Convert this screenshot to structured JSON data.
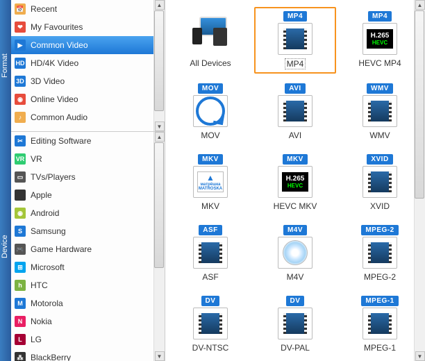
{
  "rail": {
    "format": "Format",
    "device": "Device"
  },
  "sidebar": {
    "format": [
      {
        "label": "Recent",
        "icon": "recent-icon",
        "color": "#f0ad4e",
        "glyph": "📅"
      },
      {
        "label": "My Favourites",
        "icon": "favourites-icon",
        "color": "#e74c3c",
        "glyph": "❤"
      },
      {
        "label": "Common Video",
        "icon": "common-video-icon",
        "color": "#1e78d6",
        "glyph": "▶",
        "selected": true
      },
      {
        "label": "HD/4K Video",
        "icon": "hd-icon",
        "color": "#1e78d6",
        "glyph": "HD"
      },
      {
        "label": "3D Video",
        "icon": "3d-icon",
        "color": "#1e78d6",
        "glyph": "3D"
      },
      {
        "label": "Online Video",
        "icon": "online-video-icon",
        "color": "#e74c3c",
        "glyph": "◉"
      },
      {
        "label": "Common Audio",
        "icon": "audio-icon",
        "color": "#f0ad4e",
        "glyph": "♪"
      }
    ],
    "device": [
      {
        "label": "Editing Software",
        "icon": "editing-icon",
        "color": "#1e78d6",
        "glyph": "✂"
      },
      {
        "label": "VR",
        "icon": "vr-icon",
        "color": "#2ecc71",
        "glyph": "VR"
      },
      {
        "label": "TVs/Players",
        "icon": "tv-icon",
        "color": "#555",
        "glyph": "▭"
      },
      {
        "label": "Apple",
        "icon": "apple-icon",
        "color": "#333",
        "glyph": ""
      },
      {
        "label": "Android",
        "icon": "android-icon",
        "color": "#a4c639",
        "glyph": "◉"
      },
      {
        "label": "Samsung",
        "icon": "samsung-icon",
        "color": "#1e78d6",
        "glyph": "S"
      },
      {
        "label": "Game Hardware",
        "icon": "game-icon",
        "color": "#555",
        "glyph": "🎮"
      },
      {
        "label": "Microsoft",
        "icon": "microsoft-icon",
        "color": "#00a4ef",
        "glyph": "⊞"
      },
      {
        "label": "HTC",
        "icon": "htc-icon",
        "color": "#7cb342",
        "glyph": "h"
      },
      {
        "label": "Motorola",
        "icon": "motorola-icon",
        "color": "#1e78d6",
        "glyph": "M"
      },
      {
        "label": "Nokia",
        "icon": "nokia-icon",
        "color": "#e91e63",
        "glyph": "N"
      },
      {
        "label": "LG",
        "icon": "lg-icon",
        "color": "#a50034",
        "glyph": "L"
      },
      {
        "label": "BlackBerry",
        "icon": "blackberry-icon",
        "color": "#333",
        "glyph": "⁂"
      }
    ]
  },
  "formats": [
    {
      "label": "All Devices",
      "badge": "",
      "kind": "devices"
    },
    {
      "label": "MP4",
      "badge": "MP4",
      "kind": "film",
      "selected": true
    },
    {
      "label": "HEVC MP4",
      "badge": "MP4",
      "kind": "hevc"
    },
    {
      "label": "MOV",
      "badge": "MOV",
      "kind": "mov"
    },
    {
      "label": "AVI",
      "badge": "AVI",
      "kind": "film"
    },
    {
      "label": "WMV",
      "badge": "WMV",
      "kind": "film"
    },
    {
      "label": "MKV",
      "badge": "MKV",
      "kind": "matroska"
    },
    {
      "label": "HEVC MKV",
      "badge": "MKV",
      "kind": "hevc"
    },
    {
      "label": "XVID",
      "badge": "XVID",
      "kind": "film"
    },
    {
      "label": "ASF",
      "badge": "ASF",
      "kind": "film"
    },
    {
      "label": "M4V",
      "badge": "M4V",
      "kind": "disc"
    },
    {
      "label": "MPEG-2",
      "badge": "MPEG-2",
      "kind": "film"
    },
    {
      "label": "DV-NTSC",
      "badge": "DV",
      "kind": "film"
    },
    {
      "label": "DV-PAL",
      "badge": "DV",
      "kind": "film"
    },
    {
      "label": "MPEG-1",
      "badge": "MPEG-1",
      "kind": "film"
    }
  ]
}
